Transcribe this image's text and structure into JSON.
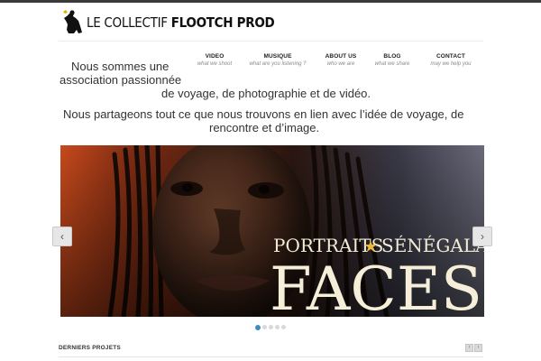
{
  "brand": {
    "logo_text_light": "LE COLLECTIF ",
    "logo_text_bold": "FLOOTCH PROD"
  },
  "nav": [
    {
      "label": "VIDEO",
      "sub": "what we shoot"
    },
    {
      "label": "MUSIQUE",
      "sub": "what are you listening ?"
    },
    {
      "label": "ABOUT US",
      "sub": "who we are"
    },
    {
      "label": "BLOG",
      "sub": "what we share"
    },
    {
      "label": "CONTACT",
      "sub": "may we help you"
    }
  ],
  "intro": {
    "line1": "Nous sommes une",
    "line2": "association passionnée",
    "line3": "de voyage, de photographie et de vidéo.",
    "line4": "Nous partageons tout ce que nous trouvons en lien avec l’idée de voyage, de",
    "line5": "rencontre et d’image."
  },
  "slider": {
    "caption_small": "PORTRAITS",
    "caption_small_2": "SÉNÉGALAIS",
    "caption_big": "FACES",
    "prev_label": "‹",
    "next_label": "›",
    "slide_count": 5,
    "active_slide": 1
  },
  "projects": {
    "title": "DERNIERS PROJETS",
    "prev": "‹",
    "next": "›"
  },
  "colors": {
    "accent": "#3b8ec4",
    "topbar": "#3a3a3a"
  }
}
